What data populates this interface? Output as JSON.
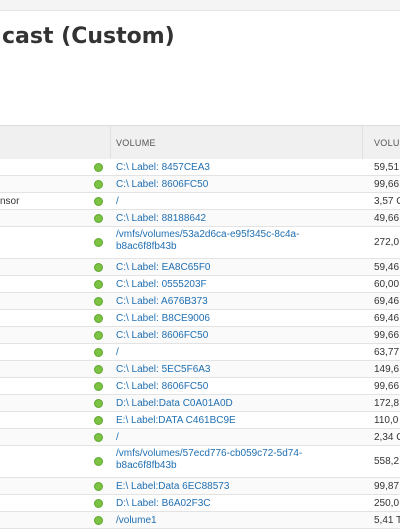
{
  "page": {
    "title": "cast (Custom)"
  },
  "table": {
    "headers": {
      "volume": "VOLUME",
      "volume_size": "VOLUM"
    },
    "rows": [
      {
        "left": "",
        "volume": "C:\\ Label: 8457CEA3",
        "size": "59,51",
        "status": "green"
      },
      {
        "left": "",
        "volume": "C:\\ Label: 8606FC50",
        "size": "99,66",
        "status": "green"
      },
      {
        "left": "nsor",
        "volume": "/",
        "size": "3,57 C",
        "status": "green"
      },
      {
        "left": "",
        "volume": "C:\\ Label: 88188642",
        "size": "49,66",
        "status": "green"
      },
      {
        "left": "",
        "volume": "/vmfs/volumes/53a2d6ca-e95f345c-8c4a-",
        "volume2": "b8ac6f8fb43b",
        "size": "272,0",
        "status": "green"
      },
      {
        "left": "",
        "volume": "C:\\ Label: EA8C65F0",
        "size": "59,46",
        "status": "green"
      },
      {
        "left": "",
        "volume": "C:\\ Label: 0555203F",
        "size": "60,00",
        "status": "green"
      },
      {
        "left": "",
        "volume": "C:\\ Label: A676B373",
        "size": "69,46",
        "status": "green"
      },
      {
        "left": "",
        "volume": "C:\\ Label: B8CE9006",
        "size": "69,46",
        "status": "green"
      },
      {
        "left": "",
        "volume": "C:\\ Label: 8606FC50",
        "size": "99,66",
        "status": "green"
      },
      {
        "left": "",
        "volume": "/",
        "size": "63,77",
        "status": "green"
      },
      {
        "left": "",
        "volume": "C:\\ Label: 5EC5F6A3",
        "size": "149,6",
        "status": "green"
      },
      {
        "left": "",
        "volume": "C:\\ Label: 8606FC50",
        "size": "99,66",
        "status": "green"
      },
      {
        "left": "",
        "volume": "D:\\ Label:Data C0A01A0D",
        "size": "172,8",
        "status": "green"
      },
      {
        "left": "",
        "volume": "E:\\ Label:DATA C461BC9E",
        "size": "110,0",
        "status": "green"
      },
      {
        "left": "",
        "volume": "/",
        "size": "2,34 C",
        "status": "green"
      },
      {
        "left": "",
        "volume": "/vmfs/volumes/57ecd776-cb059c72-5d74-",
        "volume2": "b8ac6f8fb43b",
        "size": "558,2",
        "status": "green"
      },
      {
        "left": "",
        "volume": "E:\\ Label:Data 6EC88573",
        "size": "99,87",
        "status": "green"
      },
      {
        "left": "",
        "volume": "D:\\ Label: B6A02F3C",
        "size": "250,0",
        "status": "green"
      },
      {
        "left": "",
        "volume": "/volume1",
        "size": "5,41 T",
        "status": "green"
      }
    ]
  },
  "colors": {
    "status_ok": "#7cc243",
    "link": "#1f6fb2",
    "header_bg": "#f0f0f0"
  }
}
